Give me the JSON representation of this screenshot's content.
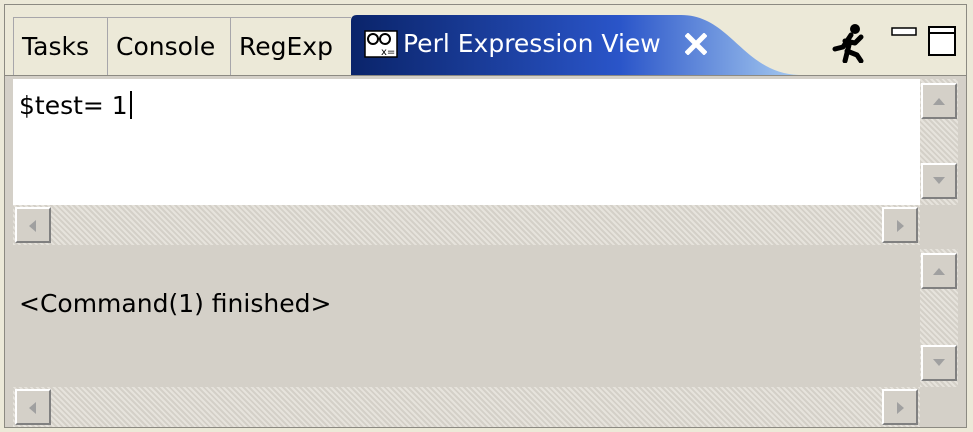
{
  "tabs": [
    {
      "label": "Tasks"
    },
    {
      "label": "Console"
    },
    {
      "label": "RegExp"
    }
  ],
  "active_tab": {
    "label": "Perl Expression View"
  },
  "toolbar": {
    "run_icon": "running-man-icon",
    "minimize_icon": "minimize-icon",
    "maximize_icon": "maximize-icon"
  },
  "input_editor": {
    "value": "$test= 1"
  },
  "output_editor": {
    "value": "<Command(1) finished>"
  },
  "colors": {
    "active_tab": "#1c3fa8",
    "panel_bg": "#d4d0c8",
    "strip_bg": "#ece9d8"
  }
}
